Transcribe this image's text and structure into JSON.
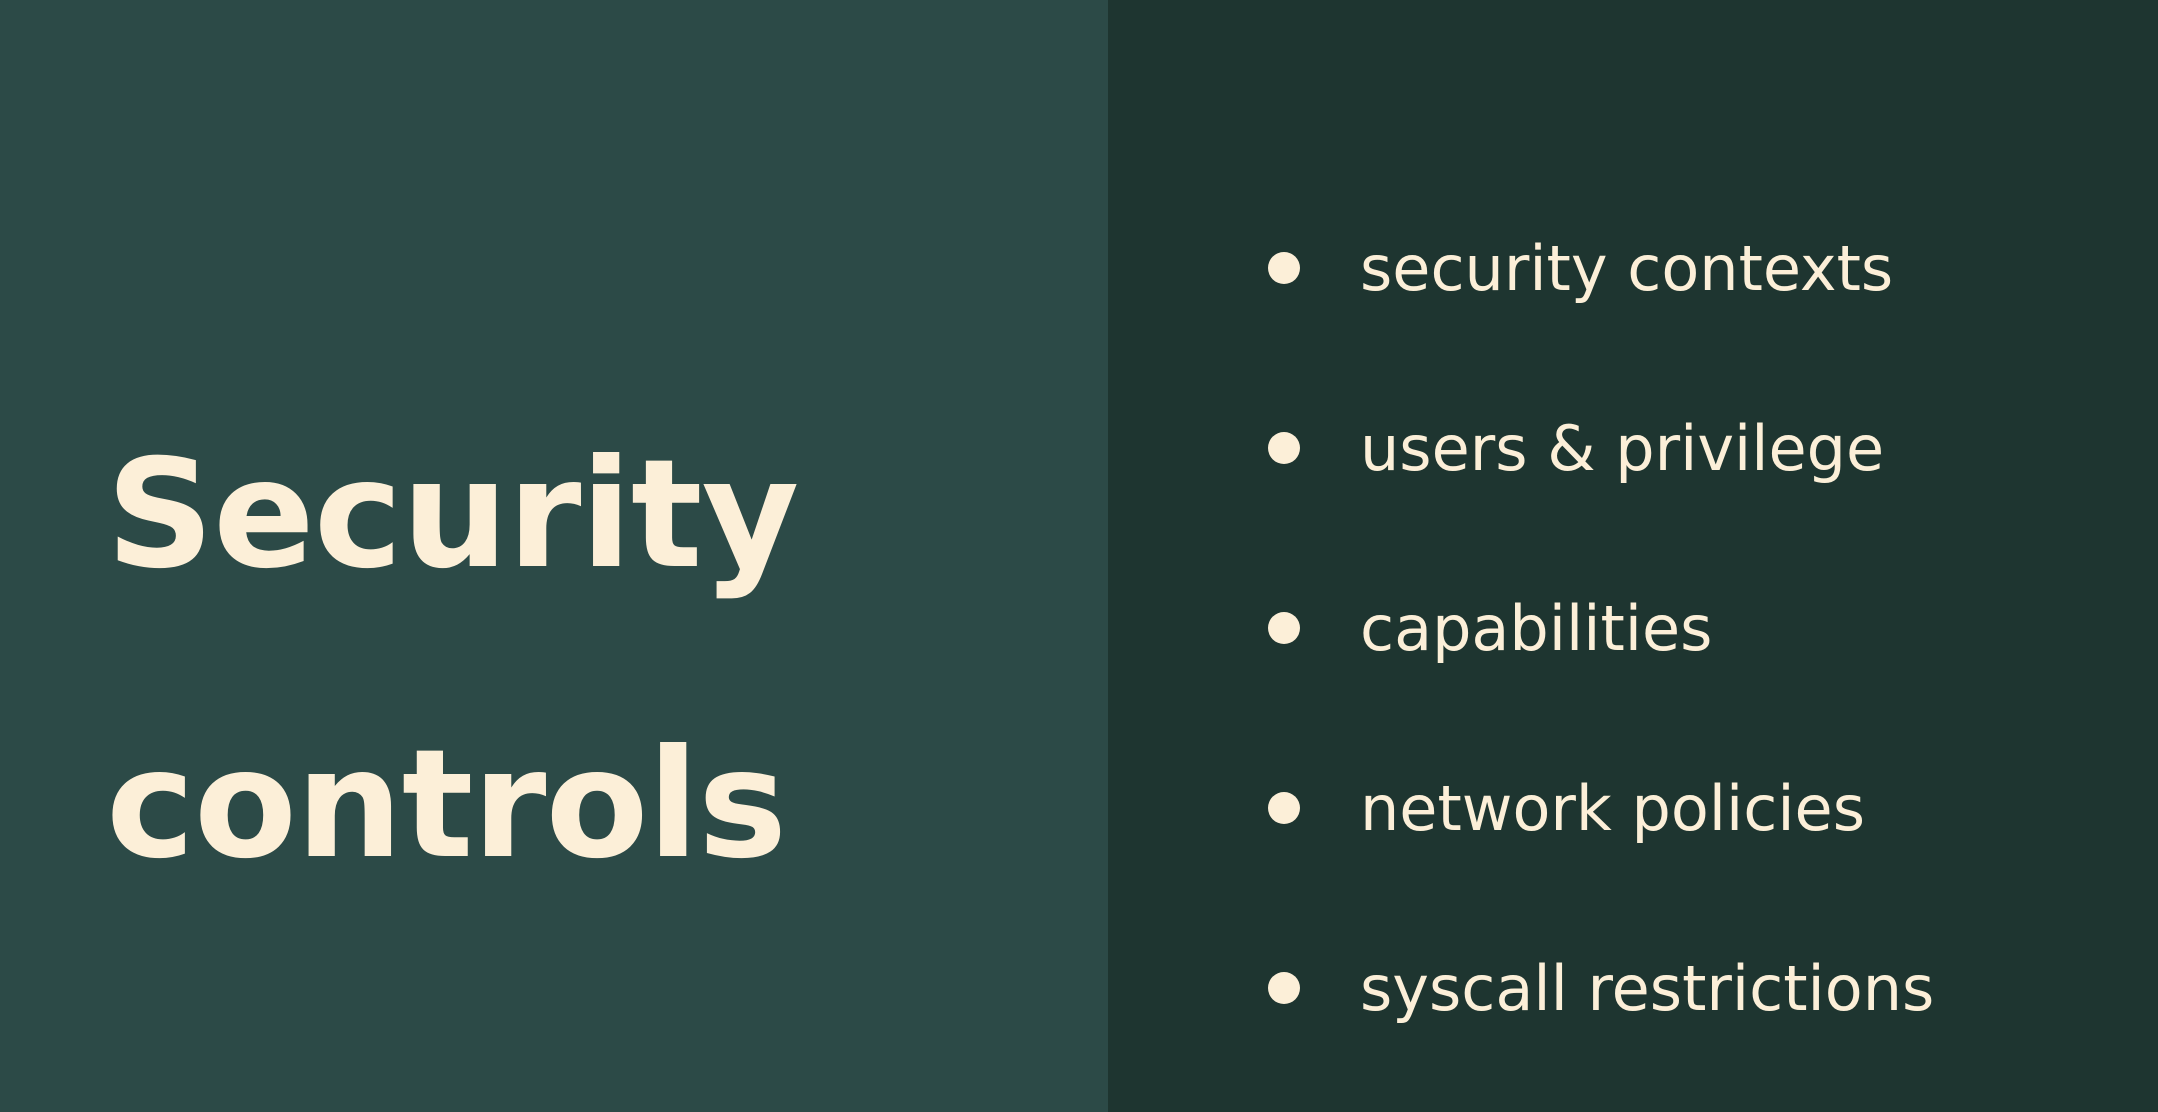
{
  "slide": {
    "title_line1": "Security",
    "title_line2": "controls",
    "bullets": [
      "security contexts",
      "users & privilege",
      "capabilities",
      "network policies",
      "syscall restrictions"
    ],
    "colors": {
      "left_bg": "#2c4a47",
      "right_bg": "#1e3530",
      "text": "#fcefd8"
    }
  }
}
